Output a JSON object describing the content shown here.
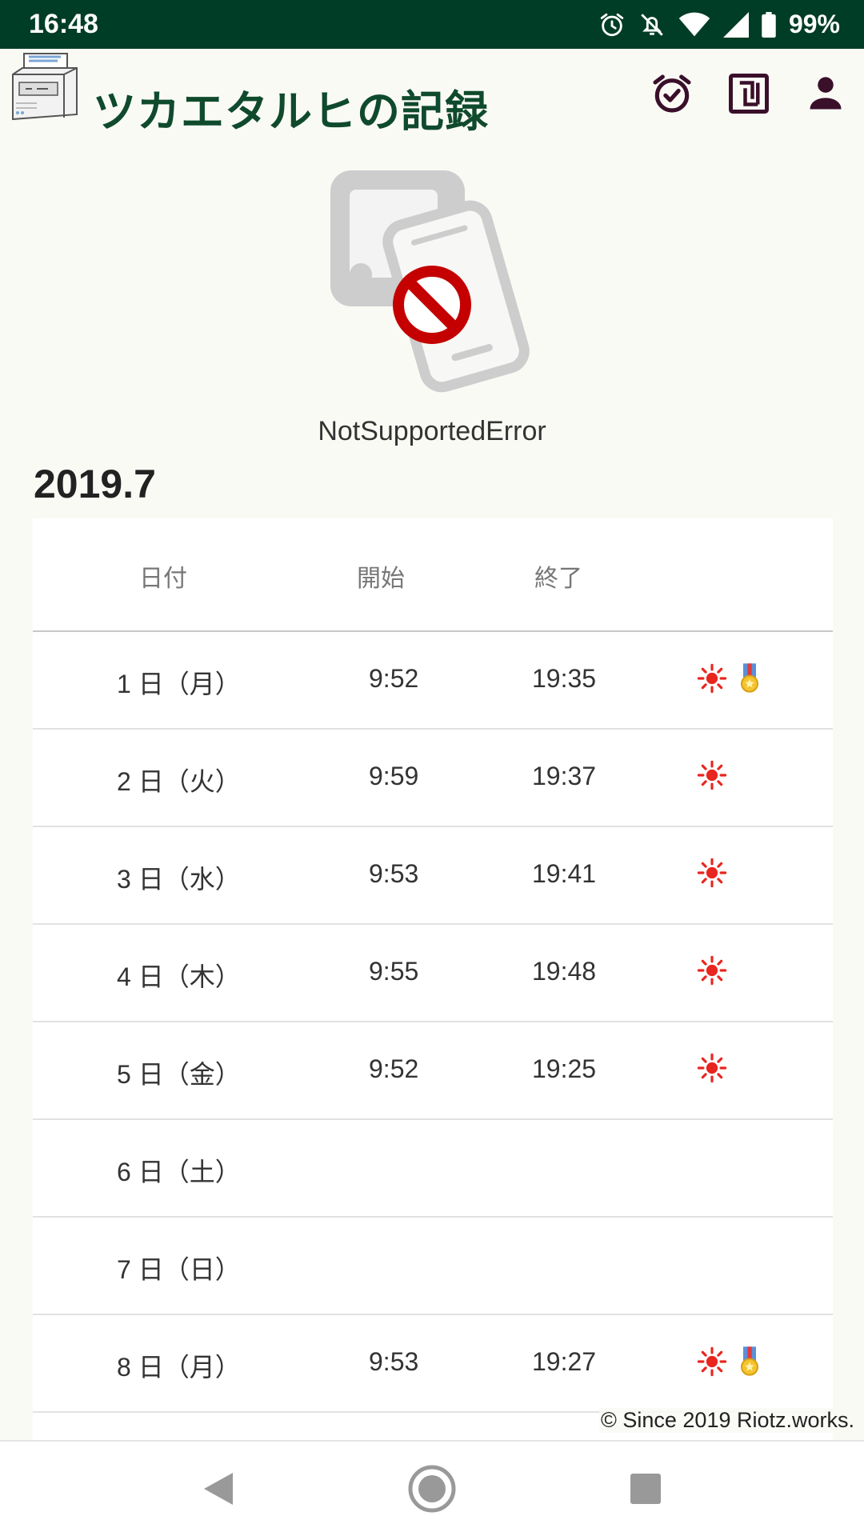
{
  "status_bar": {
    "time": "16:48",
    "battery": "99%",
    "icons": [
      "alarm-icon",
      "notifications-off-icon",
      "wifi-icon",
      "cell-signal-icon",
      "battery-icon"
    ]
  },
  "header": {
    "title": "ツカエタルヒの記録",
    "logo_icon": "time-clock-machine-icon",
    "actions": [
      {
        "name": "alarm-check-button",
        "icon": "alarm-check-icon"
      },
      {
        "name": "nfc-button",
        "icon": "nfc-icon"
      },
      {
        "name": "account-button",
        "icon": "account-icon"
      }
    ]
  },
  "error": {
    "message": "NotSupportedError",
    "icon": "nfc-not-supported-icon"
  },
  "month": {
    "title": "2019.7"
  },
  "table": {
    "headers": {
      "date": "日付",
      "start": "開始",
      "end": "終了"
    },
    "rows": [
      {
        "date": "1 日（月）",
        "start": "9:52",
        "end": "19:35",
        "sun": true,
        "medal": true
      },
      {
        "date": "2 日（火）",
        "start": "9:59",
        "end": "19:37",
        "sun": true,
        "medal": false
      },
      {
        "date": "3 日（水）",
        "start": "9:53",
        "end": "19:41",
        "sun": true,
        "medal": false
      },
      {
        "date": "4 日（木）",
        "start": "9:55",
        "end": "19:48",
        "sun": true,
        "medal": false
      },
      {
        "date": "5 日（金）",
        "start": "9:52",
        "end": "19:25",
        "sun": true,
        "medal": false
      },
      {
        "date": "6 日（土）",
        "start": "",
        "end": "",
        "sun": false,
        "medal": false
      },
      {
        "date": "7 日（日）",
        "start": "",
        "end": "",
        "sun": false,
        "medal": false
      },
      {
        "date": "8 日（月）",
        "start": "9:53",
        "end": "19:27",
        "sun": true,
        "medal": true
      }
    ]
  },
  "footer": {
    "copyright": "© Since 2019 Riotz.works."
  },
  "nav": {
    "buttons": [
      "back-button",
      "home-button",
      "recents-button"
    ]
  },
  "colors": {
    "status_bar": "#003d26",
    "title": "#0f4a2c",
    "icon_dark": "#3a0f2a",
    "sun": "#e8261f",
    "error_red": "#c40000"
  }
}
